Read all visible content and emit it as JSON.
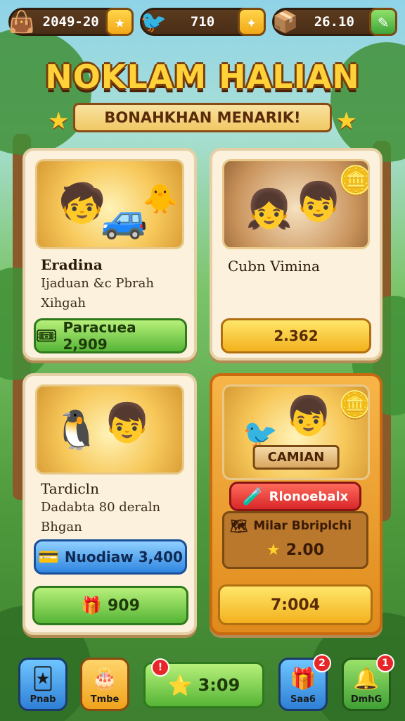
{
  "top_bar": {
    "resource_1": {
      "value": "2049-20",
      "icon": "star-bag-icon",
      "action_icon": "star-icon"
    },
    "resource_2": {
      "value": "710",
      "icon": "bird-icon",
      "action_icon": "sparkle-icon"
    },
    "resource_3": {
      "value": "26.10",
      "icon": "box-icon",
      "action_icon": "pencil-icon"
    }
  },
  "header": {
    "title": "NOKLAM HALIAN",
    "subtitle": "BONAHKHAN MENARIK!"
  },
  "cards": [
    {
      "title": "Eradina",
      "line1": "Ijaduan &c Pbrah",
      "line2": "Xihgah",
      "button_label": "Paracuea 2,909",
      "button_icon": "ticket-icon"
    },
    {
      "title": "Cubn Vimina",
      "button_label": "2.362"
    },
    {
      "title": "Tardicln",
      "line1": "Dadabta 80 deraln",
      "line2": "Bhgan",
      "button_label": "Nuodiaw 3,400",
      "button_icon": "wallet-icon",
      "secondary_label": "909",
      "secondary_icon": "gift-icon"
    },
    {
      "banner": "CAMIAN",
      "tag_label": "Rlonoebalx",
      "tag_icon": "potion-icon",
      "info_label": "Milar Bbriplchi",
      "info_icon": "map-icon",
      "info_value": "2.00",
      "info_value_icon": "star-icon",
      "button_label": "7:004"
    }
  ],
  "bottom_nav": {
    "item_1": {
      "label": "Pnab",
      "icon": "cards-icon"
    },
    "item_2": {
      "label": "Tmbe",
      "icon": "cake-icon"
    },
    "center": {
      "value": "3:09",
      "icon": "star-chest-icon",
      "badge": "!"
    },
    "item_4": {
      "label": "Saa6",
      "icon": "gift-box-icon",
      "badge": "2"
    },
    "item_5": {
      "label": "DmhG",
      "icon": "bell-icon",
      "badge": "1"
    }
  }
}
